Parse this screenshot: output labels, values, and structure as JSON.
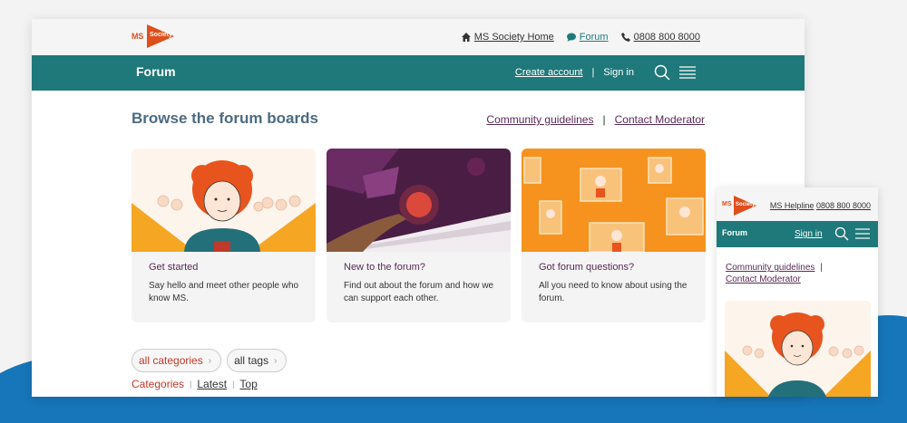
{
  "colors": {
    "teal": "#1f787a",
    "orange": "#f08b1d",
    "logo_red": "#e04e1b",
    "plum": "#5a2a56",
    "heading_blue": "#4c6b82",
    "active_red": "#c0392b",
    "wave_blue": "#1775b9"
  },
  "logo": {
    "ms": "MS",
    "society": "Society"
  },
  "topbar": {
    "links": [
      {
        "icon": "home-icon",
        "label": "MS Society Home"
      },
      {
        "icon": "chat-icon",
        "label": "Forum"
      },
      {
        "icon": "phone-icon",
        "label": "0808 800 8000"
      }
    ]
  },
  "navbar": {
    "title": "Forum",
    "create_account": "Create account",
    "separator": "|",
    "sign_in": "Sign in",
    "search_icon": "search-icon",
    "menu_icon": "hamburger-menu-icon"
  },
  "main": {
    "heading": "Browse the forum boards",
    "links": [
      "Community guidelines",
      "Contact Moderator"
    ],
    "link_separator": "|",
    "cards": [
      {
        "title": "Get started",
        "description": "Say hello and meet other people who know MS."
      },
      {
        "title": "New to the forum?",
        "description": "Find out about the forum and how we can support each other."
      },
      {
        "title": "Got forum questions?",
        "description": "All you need to know about using the forum."
      }
    ],
    "filters": [
      {
        "label": "all categories",
        "active": true
      },
      {
        "label": "all tags",
        "active": false
      }
    ],
    "tabs": [
      "Categories",
      "Latest",
      "Top"
    ],
    "tab_separator": "|"
  },
  "mobile": {
    "helpline_label": "MS Helpline",
    "helpline_number": "0808 800 8000",
    "nav_title": "Forum",
    "sign_in": "Sign in",
    "links": [
      "Community guidelines",
      "Contact Moderator"
    ],
    "link_separator": "|"
  }
}
